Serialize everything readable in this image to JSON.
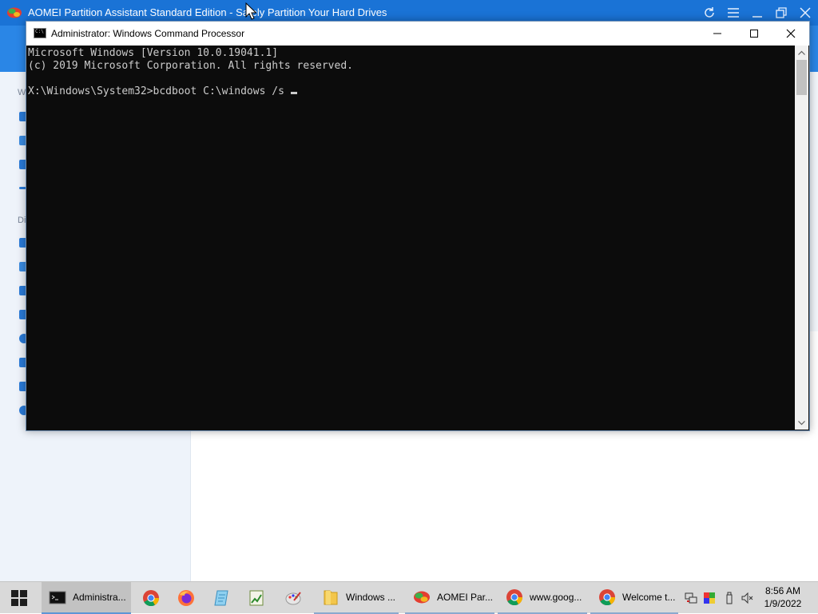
{
  "aomei": {
    "title": "AOMEI Partition Assistant Standard Edition - Safely Partition Your Hard Drives",
    "sidebar_heading_1": "W",
    "sidebar_heading_2": "Di"
  },
  "cmd": {
    "title": "Administrator: Windows Command Processor",
    "icon_text": "C:\\",
    "lines": [
      "Microsoft Windows [Version 10.0.19041.1]",
      "(c) 2019 Microsoft Corporation. All rights reserved.",
      "",
      "X:\\Windows\\System32>bcdboot C:\\windows /s"
    ]
  },
  "taskbar": {
    "items": [
      {
        "label": "Administra...",
        "icon": "cmd-icon"
      },
      {
        "label": "",
        "icon": "chrome-icon"
      },
      {
        "label": "",
        "icon": "firefox-icon"
      },
      {
        "label": "",
        "icon": "notepad-icon"
      },
      {
        "label": "",
        "icon": "spreadsheet-icon"
      },
      {
        "label": "",
        "icon": "paint-icon"
      },
      {
        "label": "Windows ...",
        "icon": "folder-icon"
      },
      {
        "label": "AOMEI Par...",
        "icon": "aomei-icon"
      },
      {
        "label": "www.goog...",
        "icon": "chrome-icon"
      },
      {
        "label": "Welcome t...",
        "icon": "chrome-icon"
      }
    ],
    "time": "8:56 AM",
    "date": "1/9/2022"
  },
  "colors": {
    "aomei_blue": "#1a73d6",
    "console_bg": "#0c0c0c",
    "console_text": "#cccccc",
    "taskbar": "#d9d9d9"
  }
}
